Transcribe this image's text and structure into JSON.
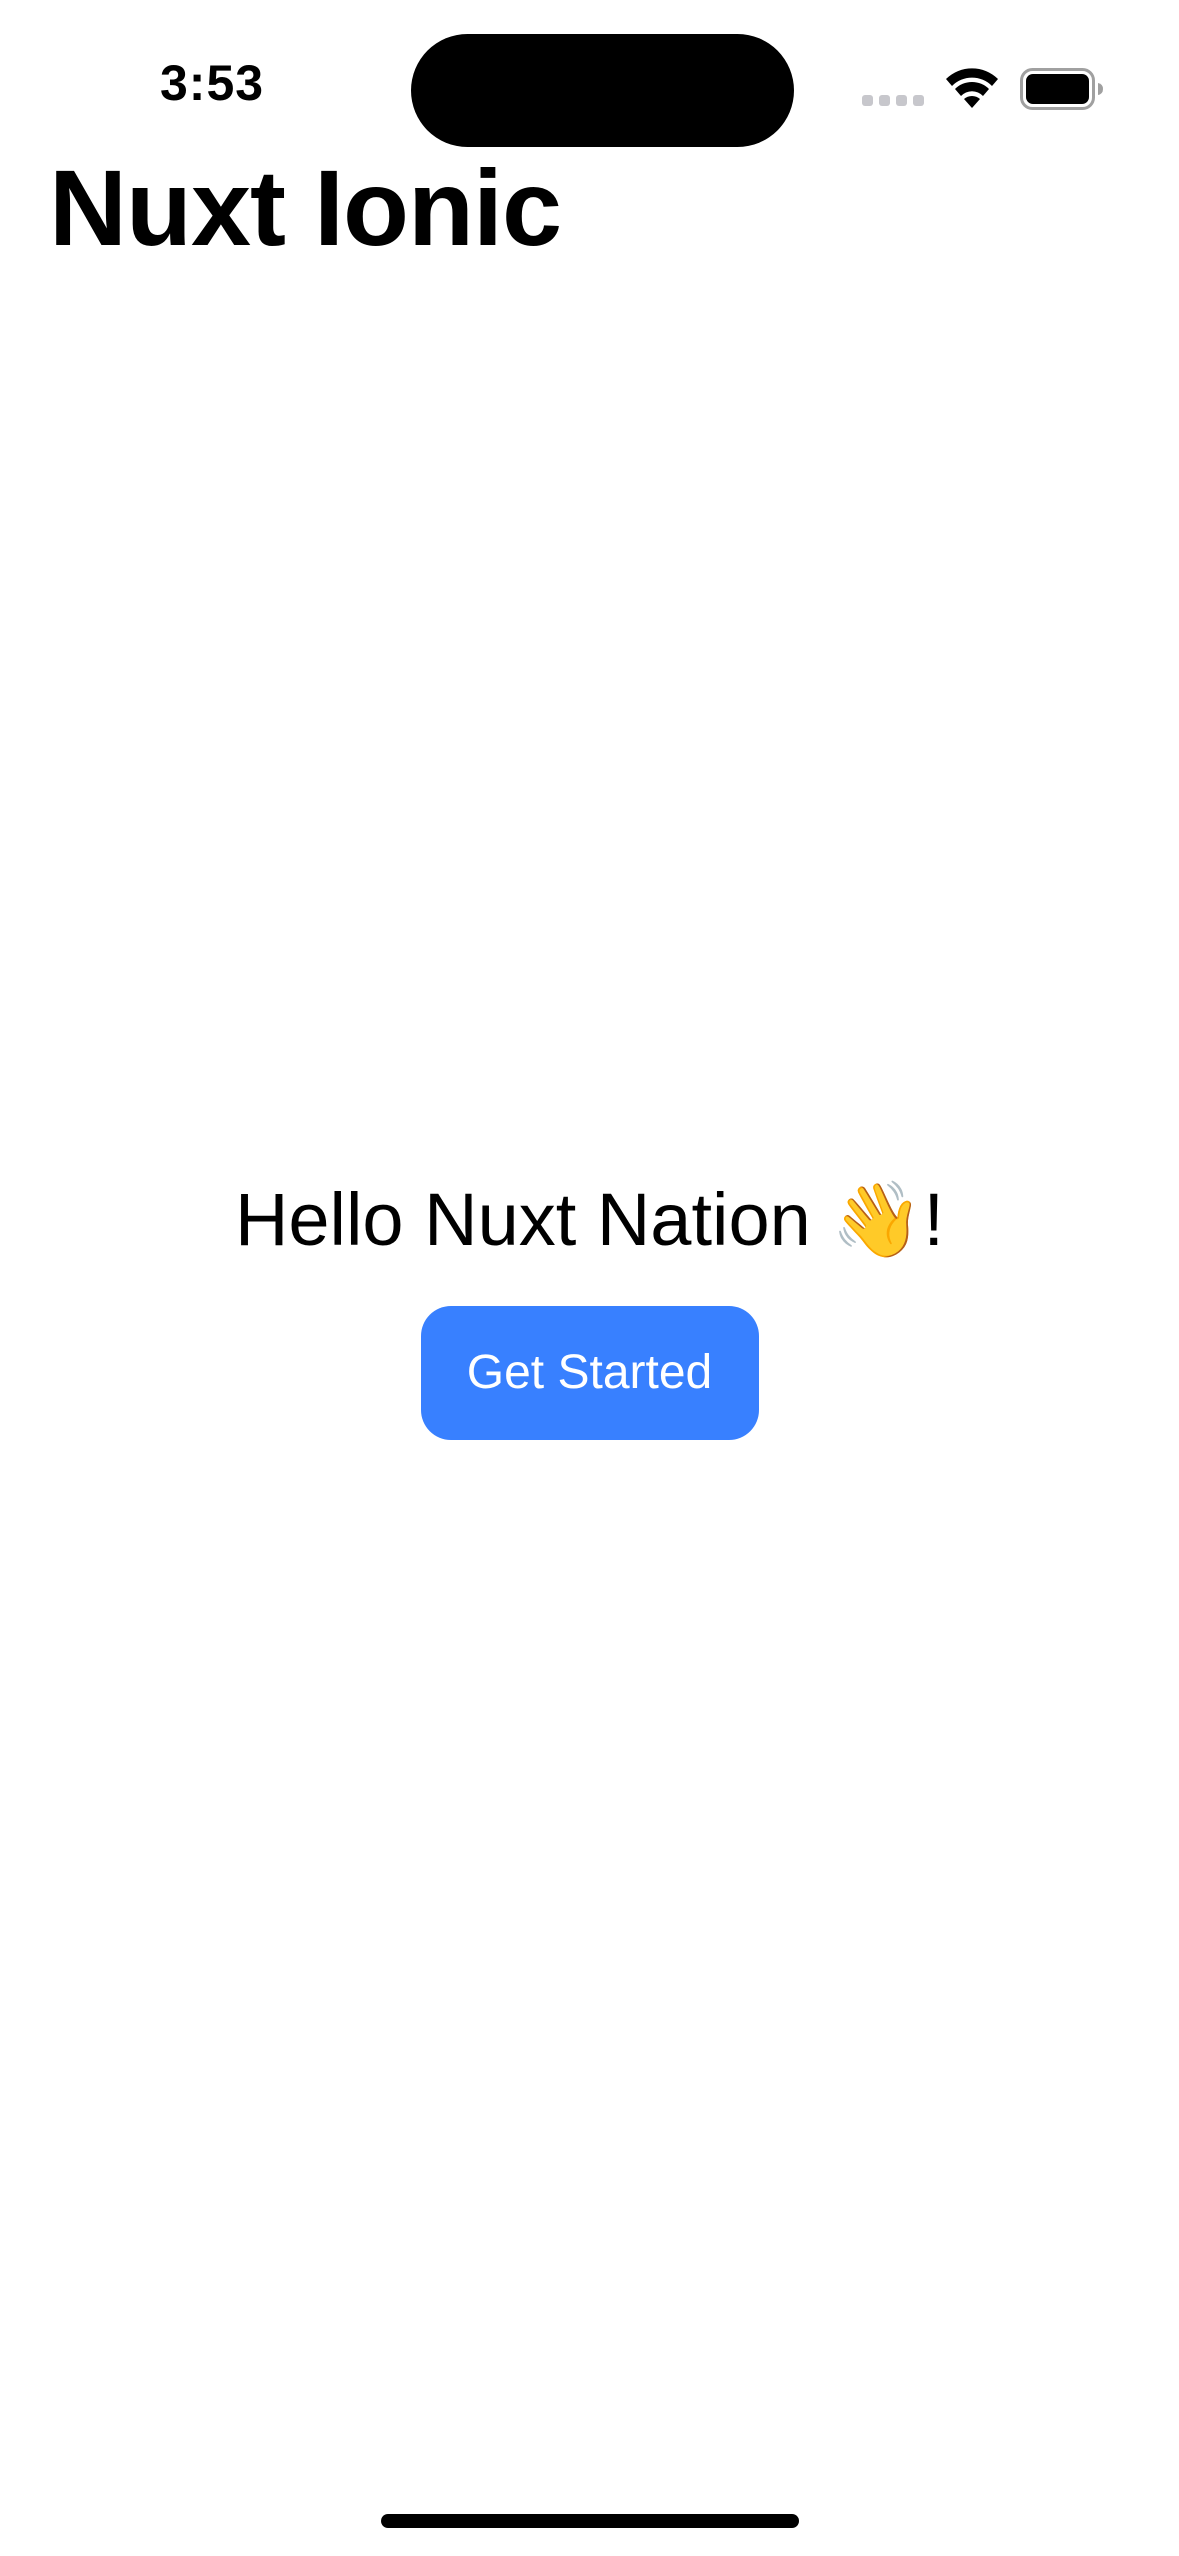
{
  "status_bar": {
    "time": "3:53",
    "icons": {
      "signal": "cellular-signal-icon",
      "wifi": "wifi-icon",
      "battery": "battery-icon"
    }
  },
  "header": {
    "title": "Nuxt Ionic"
  },
  "main": {
    "greeting_text": "Hello Nuxt Nation ",
    "greeting_emoji": "👋",
    "greeting_suffix": "!",
    "button_label": "Get Started"
  },
  "colors": {
    "accent": "#3880ff",
    "background": "#ffffff",
    "text": "#000000"
  }
}
